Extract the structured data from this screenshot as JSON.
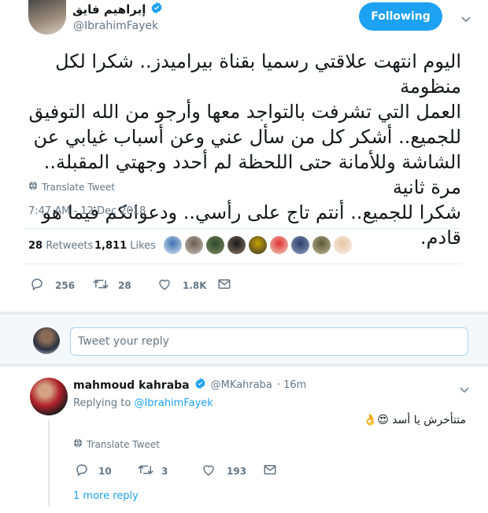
{
  "tweet": {
    "author_name": "إبراهيم فايق",
    "author_handle": "@IbrahimFayek",
    "follow_label": "Following",
    "text_lines": [
      "اليوم انتهت علاقتي رسميا بقناة بيراميدز.. شكرا لكل منظومة",
      "العمل التي تشرفت بالتواجد معها وأرجو من الله التوفيق",
      "للجميع.. أشكر كل من سأل عني وعن أسباب غيابي عن",
      "الشاشة وللأمانة حتى اللحظة لم أحدد وجهتي المقبلة.. مرة ثانية",
      "شكرا للجميع.. أنتم تاج على رأسي.. ودعواتكم فيما هو قادم."
    ],
    "translate_label": "Translate Tweet",
    "timestamp": "7:47 AM - 12 Dec 2018",
    "retweets_count": "28",
    "retweets_label": "Retweets",
    "likes_count": "1,811",
    "likes_label": "Likes",
    "actions": {
      "replies": "256",
      "retweets": "28",
      "likes": "1.8K"
    }
  },
  "reply_composer": {
    "placeholder": "Tweet your reply"
  },
  "reply": {
    "author_name": "mahmoud kahraba",
    "author_handle": "@MKahraba",
    "time": "· 16m",
    "replying_prefix": "Replying to",
    "replying_to": "@IbrahimFayek",
    "text": "متتأخرش يا أسد 😍👌",
    "translate_label": "Translate Tweet",
    "actions": {
      "replies": "10",
      "retweets": "3",
      "likes": "193"
    },
    "more_replies_label": "1 more reply"
  },
  "colors": {
    "accent": "#1da1f2",
    "verified": "#1da1f2",
    "muted": "#657786"
  },
  "icons": [
    "verified-badge-icon",
    "chevron-down-icon",
    "globe-icon",
    "reply-icon",
    "retweet-icon",
    "like-icon",
    "dm-icon"
  ]
}
